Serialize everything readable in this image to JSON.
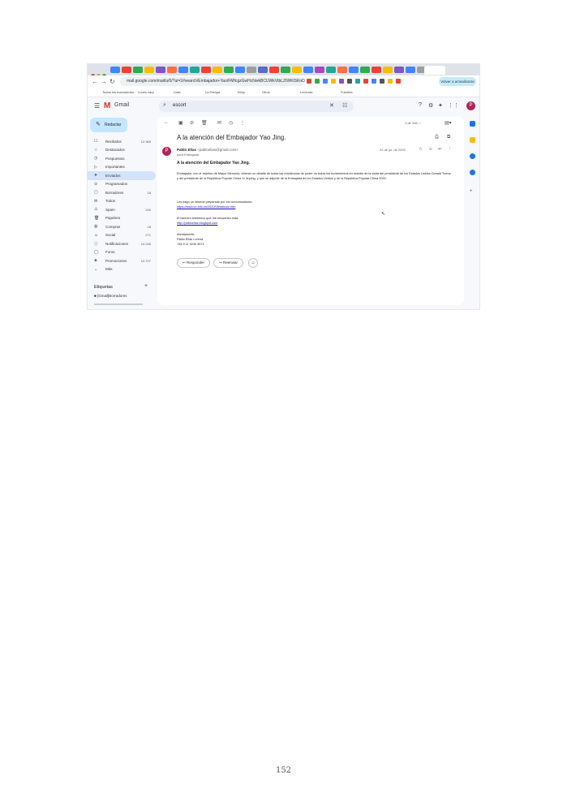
{
  "browser": {
    "url": "mail.google.com/mail/u/0/?ui=2#search/Embajador+Yao/FMfcgzGwHcNwkBCUWkVtbLZtWKlSKnDJ",
    "incognito_label": "Volver a actualizarse"
  },
  "bookmarks": [
    "Todos los marcadores",
    "Lunes carp",
    "Lista",
    "La Pampa",
    "Infop",
    "Otros",
    "Lecturas",
    "Fuentes"
  ],
  "gmail": {
    "logo_text": "Gmail",
    "search_value": "escort",
    "compose_label": "Redactar",
    "nav": [
      {
        "label": "Recibidos",
        "count": "12.369",
        "icon": "☐"
      },
      {
        "label": "Destacados",
        "count": "",
        "icon": "☆"
      },
      {
        "label": "Pospuestos",
        "count": "",
        "icon": "◷"
      },
      {
        "label": "Importantes",
        "count": "",
        "icon": "▷"
      },
      {
        "label": "Enviados",
        "count": "",
        "icon": "➤"
      },
      {
        "label": "Programados",
        "count": "",
        "icon": "⊙"
      },
      {
        "label": "Borradores",
        "count": "18",
        "icon": "▢"
      },
      {
        "label": "Todos",
        "count": "",
        "icon": "✉"
      },
      {
        "label": "Spam",
        "count": "240",
        "icon": "⚠"
      },
      {
        "label": "Papelera",
        "count": "",
        "icon": "🗑"
      },
      {
        "label": "Compras",
        "count": "18",
        "icon": "◍"
      },
      {
        "label": "Social",
        "count": "271",
        "icon": "☺"
      },
      {
        "label": "Notificaciones",
        "count": "10.045",
        "icon": "ⓘ"
      },
      {
        "label": "Foros",
        "count": "",
        "icon": "◯"
      },
      {
        "label": "Promociones",
        "count": "12.707",
        "icon": "◈"
      },
      {
        "label": "Más",
        "count": "",
        "icon": "⌄"
      }
    ],
    "labels_header": "Etiquetas",
    "labels": [
      "[Gmail]Borradores"
    ]
  },
  "email": {
    "subject": "A la atención del Embajador Yao Jing.",
    "sender_name": "Pablo Elías",
    "sender_email": "<pabloelias@gmail.com>",
    "to": "para Embajada",
    "date": "22 de jul. de 2020",
    "heading": "A la atención del Embajador Yao Jing.",
    "paragraph": "Embajador, con el objetivo de Mayor Memoria, obtener un detalle de todas las residencias de poder no todos los movimientos en estudio de la visita del presidente de los Estados Unidos Donald Trump y del presidente de la República Popular China Xi Jinping, y que se adjunte de la Embajada de los Estados Unidos y de la República Popular China 2020.",
    "link_intro": "Les hago un informe preparado por los comunicadores:",
    "link1": "https://www.cn-info.es/2020/08/articulo.htm",
    "contact_intro": "El Número telefónico que me encuentro está:",
    "link2": "http://pabloeliaz.blogspot.com",
    "signoff": "Atentamente,",
    "signature_name": "Pablo Elías Lorena",
    "signature_phone": "+54 9 11 3245 3571",
    "reply_label": "Responder",
    "forward_label": "Reenviar"
  },
  "footer": {
    "page_number": "152"
  }
}
